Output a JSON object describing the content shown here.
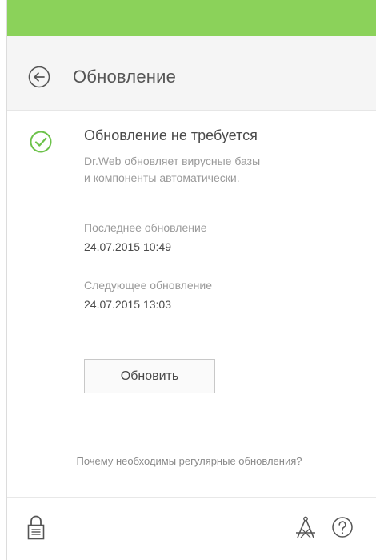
{
  "colors": {
    "accent": "#8bd25a",
    "success": "#6cc24a",
    "header_bg": "#f5f5f5"
  },
  "header": {
    "back_icon": "arrow-left-circle-icon",
    "title": "Обновление"
  },
  "status": {
    "icon": "check-circle-icon",
    "title": "Обновление не требуется",
    "description_line1": "Dr.Web обновляет вирусные базы",
    "description_line2": "и компоненты автоматически."
  },
  "last_update": {
    "label": "Последнее обновление",
    "value": "24.07.2015 10:49"
  },
  "next_update": {
    "label": "Следующее обновление",
    "value": "24.07.2015 13:03"
  },
  "actions": {
    "update_label": "Обновить",
    "why_link": "Почему необходимы регулярные обновления?"
  },
  "footer": {
    "lock_icon": "padlock-icon",
    "tools_icon": "compass-tools-icon",
    "help_icon": "question-circle-icon"
  }
}
